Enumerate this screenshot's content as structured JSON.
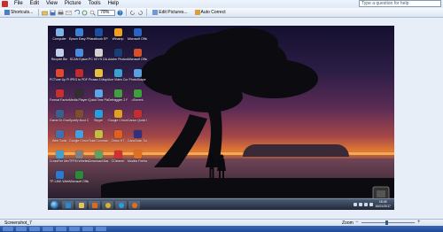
{
  "menubar": {
    "items": [
      "File",
      "Edit",
      "View",
      "Picture",
      "Tools",
      "Help"
    ],
    "help_placeholder": "Type a question for help"
  },
  "toolbar": {
    "shortcuts_label": "Shortcuts...",
    "zoom_value": "78%",
    "edit_pictures_label": "Edit Pictures...",
    "auto_correct_label": "Auto Correct"
  },
  "desktop_icons": [
    {
      "label": "Computer",
      "color": "#7fb2e5"
    },
    {
      "label": "Epson Easy Photo Print",
      "color": "#3b7fd6"
    },
    {
      "label": "Handbook EPSON",
      "color": "#1b4fa0"
    },
    {
      "label": "Winamp",
      "color": "#f0a020"
    },
    {
      "label": "Microsoft Office Wo...",
      "color": "#2b63c2"
    },
    {
      "label": "Recycle Bin",
      "color": "#bfd0e8"
    },
    {
      "label": "SCAN Epson",
      "color": "#4a8be0"
    },
    {
      "label": "PC KEYS DA...",
      "color": "#d0d0d0"
    },
    {
      "label": "Adobe Photosh...",
      "color": "#1a3d73"
    },
    {
      "label": "Microsoft Office Po...",
      "color": "#d2502a"
    },
    {
      "label": "PCTune Up Photo Hi...",
      "color": "#e04a2a"
    },
    {
      "label": "IPEG to PDF",
      "color": "#c02c2c"
    },
    {
      "label": "Picasa 3 Maplethea...",
      "color": "#e7c040"
    },
    {
      "label": "Ace Video Converter",
      "color": "#3aa0d0"
    },
    {
      "label": "PhotoScape",
      "color": "#5aa0e0"
    },
    {
      "label": "Format Factory",
      "color": "#c83030"
    },
    {
      "label": "Media Player Classic",
      "color": "#303030"
    },
    {
      "label": "QuickTime Player",
      "color": "#5aa6e6"
    },
    {
      "label": "Defraggler 2 Portable",
      "color": "#40a040"
    },
    {
      "label": "uTorrent",
      "color": "#3aa03a"
    },
    {
      "label": "Game Dr Grand Theft...",
      "color": "#3a6090"
    },
    {
      "label": "Spotify Boot Camp",
      "color": "#7a5030"
    },
    {
      "label": "Skype",
      "color": "#22a0e0"
    },
    {
      "label": "Google Chrome",
      "color": "#e0a020"
    },
    {
      "label": "Canon Quick Menu",
      "color": "#c03030"
    },
    {
      "label": "Web Tools",
      "color": "#4070b0"
    },
    {
      "label": "Google Chrome (4)",
      "color": "#40a0e0"
    },
    {
      "label": "Total Commander",
      "color": "#c0c040"
    },
    {
      "label": "Cetus HT",
      "color": "#e06020"
    },
    {
      "label": "CanoScan Toolbox 5.0",
      "color": "#303080"
    },
    {
      "label": "CrossFire Media Player",
      "color": "#40a0d0"
    },
    {
      "label": "TPFM Wireless",
      "color": "#808080"
    },
    {
      "label": "Download Manager",
      "color": "#60a060"
    },
    {
      "label": "CCleaner",
      "color": "#d03030"
    },
    {
      "label": "Mozilla Firefox",
      "color": "#e07020"
    },
    {
      "label": "TP-LINK Wireless C...",
      "color": "#2a7ad0"
    },
    {
      "label": "Microsoft Office Ex...",
      "color": "#2a8a3a"
    }
  ],
  "taskbar": {
    "clock_time": "18:45",
    "clock_date": "16/01/2017"
  },
  "statusbar": {
    "filename": "Screenshot_7",
    "zoom_label": "Zoom",
    "zoom_level": 0.48
  }
}
